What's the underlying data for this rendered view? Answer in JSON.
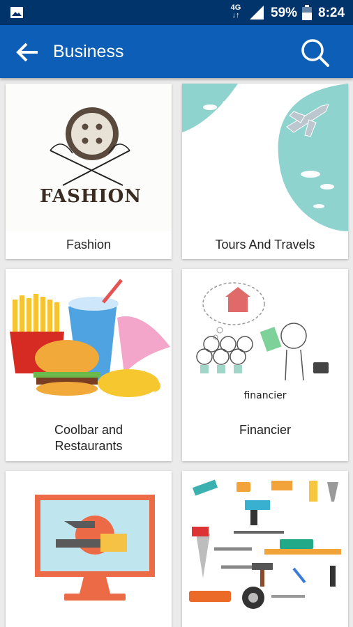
{
  "status_bar": {
    "network": "4G",
    "battery_percent": "59%",
    "time": "8:24"
  },
  "app_bar": {
    "title": "Business"
  },
  "categories": [
    {
      "label": "Fashion",
      "image_text": "FASHION"
    },
    {
      "label": "Tours And Travels"
    },
    {
      "label_line1": "Coolbar and",
      "label_line2": "Restaurants"
    },
    {
      "label": "Financier",
      "image_text": "financier"
    },
    {
      "label": ""
    },
    {
      "label": ""
    }
  ],
  "colors": {
    "status_bar": "#01346b",
    "app_bar": "#0d5eb6",
    "background": "#ebebeb"
  }
}
